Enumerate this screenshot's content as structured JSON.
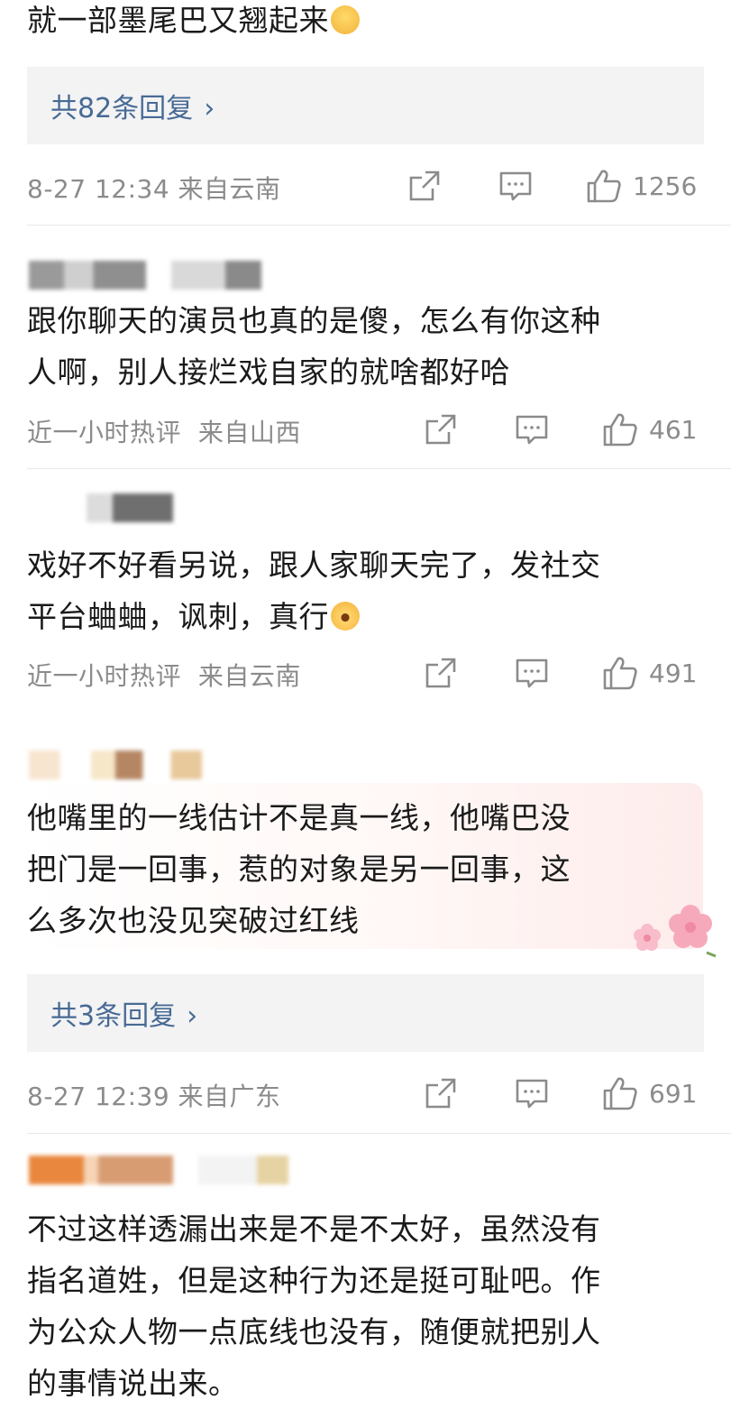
{
  "comments": [
    {
      "text": "就一部墨尾巴又翘起来",
      "emoji": "sweat-smile-emoji",
      "reply_link": "共82条回复",
      "time": "8-27 12:34",
      "location": "来自云南",
      "likes": "1256"
    },
    {
      "line1": "跟你聊天的演员也真的是傻，怎么有你这种",
      "line2": "人啊，别人接烂戏自家的就啥都好哈",
      "time": "近一小时热评",
      "location": "来自山西",
      "likes": "461"
    },
    {
      "line1": "戏好不好看另说，跟人家聊天完了，发社交",
      "line2": "平台蛐蛐，讽刺，真行",
      "emoji": "astonished-emoji",
      "time": "近一小时热评",
      "location": "来自云南",
      "likes": "491"
    },
    {
      "line1": "他嘴里的一线估计不是真一线，他嘴巴没",
      "line2": "把门是一回事，惹的对象是另一回事，这",
      "line3": "么多次也没见突破过红线",
      "reply_link": "共3条回复",
      "time": "8-27 12:39",
      "location": "来自广东",
      "likes": "691"
    },
    {
      "line1": "不过这样透漏出来是不是不太好，虽然没有",
      "line2": "指名道姓，但是这种行为还是挺可耻吧。作",
      "line3": "为公众人物一点底线也没有，随便就把别人",
      "line4": "的事情说出来。"
    }
  ],
  "icons": {
    "share": "share-icon",
    "comment": "comment-icon",
    "like": "thumbs-up-icon"
  },
  "colors": {
    "link": "#476a94",
    "meta": "#8b8b8b",
    "reply_bg": "#f3f3f4"
  }
}
